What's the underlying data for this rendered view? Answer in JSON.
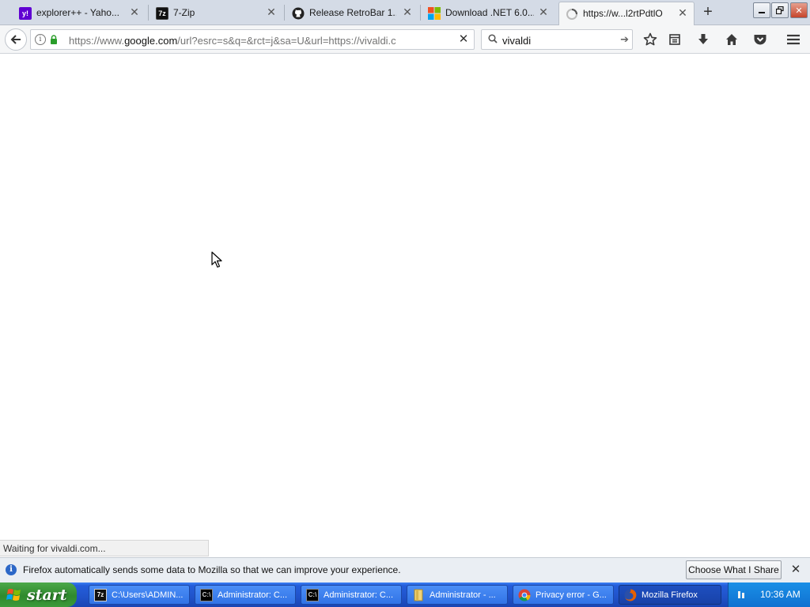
{
  "browser": {
    "tabs": [
      {
        "title": "explorer++ - Yaho...",
        "favicon": "yahoo-icon",
        "color": "#6001d2",
        "active": false
      },
      {
        "title": "7-Zip",
        "favicon": "7zip-icon",
        "color": "#111111",
        "active": false
      },
      {
        "title": "Release RetroBar 1....",
        "favicon": "github-icon",
        "color": "#222222",
        "active": false
      },
      {
        "title": "Download .NET 6.0...",
        "favicon": "microsoft-icon",
        "color": "#f25022",
        "active": false
      },
      {
        "title": "https://w...l2rtPdtlO",
        "favicon": "loading-icon",
        "color": "#888888",
        "active": true
      }
    ],
    "url": {
      "prefix": "https://www.",
      "domain": "google.com",
      "rest": "/url?esrc=s&q=&rct=j&sa=U&url=https://vivaldi.c"
    },
    "search": {
      "value": "vivaldi"
    },
    "status_text": "Waiting for vivaldi.com..."
  },
  "notification": {
    "text": "Firefox automatically sends some data to Mozilla so that we can improve your experience.",
    "button_label": "Choose What I Share"
  },
  "taskbar": {
    "start_label": "start",
    "tasks": [
      {
        "label": "C:\\Users\\ADMIN...",
        "icon": "7zip-icon",
        "active": false
      },
      {
        "label": "Administrator: C...",
        "icon": "cmd-icon",
        "active": false
      },
      {
        "label": "Administrator: C...",
        "icon": "cmd-icon",
        "active": false
      },
      {
        "label": "Administrator - ...",
        "icon": "folder-icon",
        "active": false
      },
      {
        "label": "Privacy error - G...",
        "icon": "chrome-icon",
        "active": false
      },
      {
        "label": "Mozilla Firefox",
        "icon": "firefox-icon",
        "active": true
      }
    ],
    "clock": "10:36 AM"
  },
  "colors": {
    "accent": "#2052c9",
    "start_green": "#2f8a2d",
    "tray_blue": "#1071d1"
  }
}
